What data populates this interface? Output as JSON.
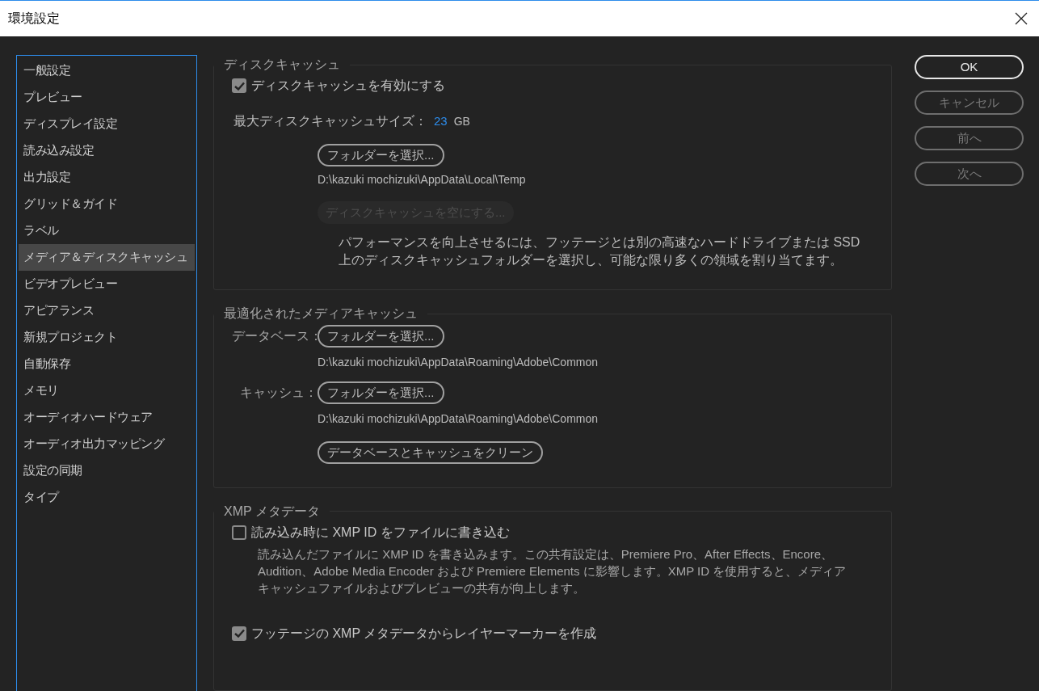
{
  "window": {
    "title": "環境設定"
  },
  "sidebar": {
    "items": [
      {
        "label": "一般設定",
        "selected": false
      },
      {
        "label": "プレビュー",
        "selected": false
      },
      {
        "label": "ディスプレイ設定",
        "selected": false
      },
      {
        "label": "読み込み設定",
        "selected": false
      },
      {
        "label": "出力設定",
        "selected": false
      },
      {
        "label": "グリッド＆ガイド",
        "selected": false
      },
      {
        "label": "ラベル",
        "selected": false
      },
      {
        "label": "メディア＆ディスクキャッシュ",
        "selected": true
      },
      {
        "label": "ビデオプレビュー",
        "selected": false
      },
      {
        "label": "アピアランス",
        "selected": false
      },
      {
        "label": "新規プロジェクト",
        "selected": false
      },
      {
        "label": "自動保存",
        "selected": false
      },
      {
        "label": "メモリ",
        "selected": false
      },
      {
        "label": "オーディオハードウェア",
        "selected": false
      },
      {
        "label": "オーディオ出力マッピング",
        "selected": false
      },
      {
        "label": "設定の同期",
        "selected": false
      },
      {
        "label": "タイプ",
        "selected": false
      }
    ]
  },
  "disk_cache": {
    "title": "ディスクキャッシュ",
    "enable": {
      "label": "ディスクキャッシュを有効にする",
      "checked": true
    },
    "max_size": {
      "label": "最大ディスクキャッシュサイズ：",
      "value": "23",
      "unit": "GB"
    },
    "folder_button": "フォルダーを選択...",
    "path": "D:\\kazuki mochizuki\\AppData\\Local\\Temp",
    "empty_button": {
      "label": "ディスクキャッシュを空にする...",
      "disabled": true
    },
    "description": "パフォーマンスを向上させるには、フッテージとは別の高速なハードドライブまたは SSD 上のディスクキャッシュフォルダーを選択し、可能な限り多くの領域を割り当てます。"
  },
  "media_cache": {
    "title": "最適化されたメディアキャッシュ",
    "rows": [
      {
        "label": "データベース：",
        "button": "フォルダーを選択...",
        "path": "D:\\kazuki mochizuki\\AppData\\Roaming\\Adobe\\Common"
      },
      {
        "label": "キャッシュ：",
        "button": "フォルダーを選択...",
        "path": "D:\\kazuki mochizuki\\AppData\\Roaming\\Adobe\\Common"
      }
    ],
    "clean_button": "データベースとキャッシュをクリーン"
  },
  "xmp": {
    "title": "XMP メタデータ",
    "write": {
      "label": "読み込み時に XMP ID をファイルに書き込む",
      "checked": false
    },
    "description": "読み込んだファイルに XMP ID を書き込みます。この共有設定は、Premiere Pro、After Effects、Encore、Audition、Adobe Media Encoder および Premiere Elements に影響します。XMP ID を使用すると、メディアキャッシュファイルおよびプレビューの共有が向上します。",
    "markers": {
      "label": "フッテージの XMP メタデータからレイヤーマーカーを作成",
      "checked": true
    }
  },
  "buttons": [
    {
      "label": "OK",
      "default": true
    },
    {
      "label": "キャンセル",
      "default": false
    },
    {
      "label": "前へ",
      "default": false
    },
    {
      "label": "次へ",
      "default": false
    }
  ]
}
